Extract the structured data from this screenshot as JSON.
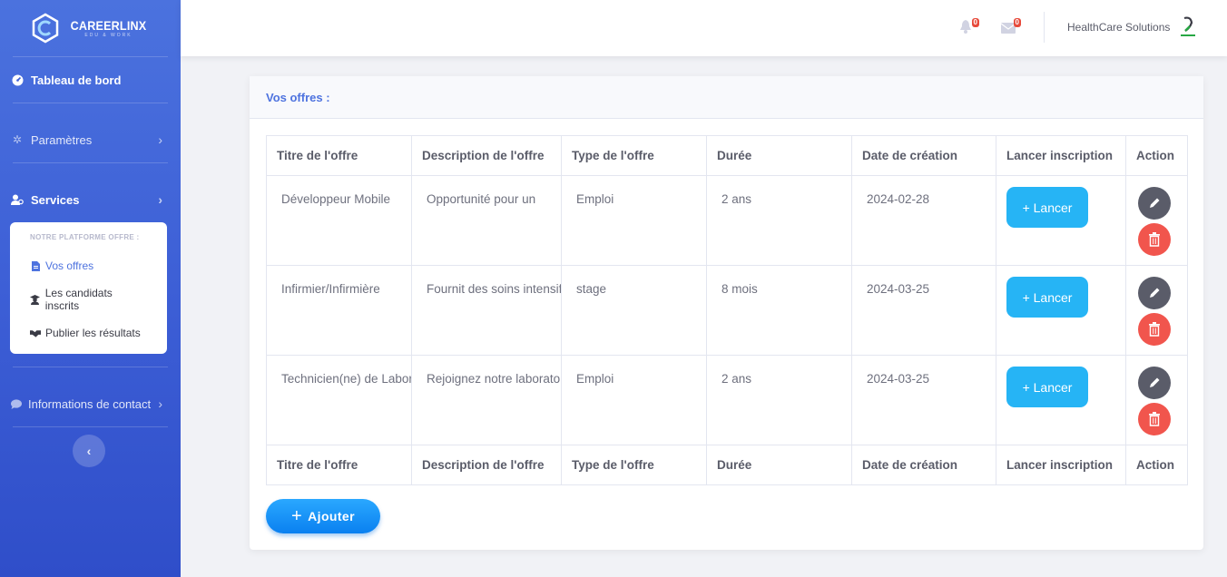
{
  "brand": {
    "name": "CAREERLINX",
    "tagline": "EDU & WORK"
  },
  "sidebar": {
    "dashboard": "Tableau de bord",
    "settings": "Paramètres",
    "services": "Services",
    "submenu": {
      "heading": "NOTRE PLATFORME OFFRE :",
      "items": [
        {
          "label": "Vos offres",
          "icon": "file-icon"
        },
        {
          "label": "Les candidats inscrits",
          "icon": "graduate-icon"
        },
        {
          "label": "Publier les résultats",
          "icon": "handshake-icon"
        }
      ]
    },
    "contact": "Informations de contact",
    "toggle": "‹"
  },
  "topbar": {
    "alerts_count": "0",
    "messages_count": "0",
    "user_name": "HealthCare Solutions"
  },
  "card": {
    "title": "Vos offres :",
    "columns": [
      "Titre de l'offre",
      "Description de l'offre",
      "Type de l'offre",
      "Durée",
      "Date de création",
      "Lancer inscription",
      "Action"
    ],
    "rows": [
      {
        "title": "Développeur Mobile",
        "description": "Opportunité pour un",
        "type": "Emploi",
        "duration": "2 ans",
        "date": "2024-02-28"
      },
      {
        "title": "Infirmier/Infirmière",
        "description": "Fournit des soins intensifs",
        "type": "stage",
        "duration": "8 mois",
        "date": "2024-03-25"
      },
      {
        "title": "Technicien(ne) de Laboratoire",
        "description": "Rejoignez notre laboratoire",
        "type": "Emploi",
        "duration": "2 ans",
        "date": "2024-03-25"
      }
    ],
    "lancer_label": "+ Lancer",
    "add_label": "Ajouter"
  },
  "colors": {
    "sidebar": "#4b72de",
    "accent": "#4e73df",
    "lancer": "#26b4f5",
    "delete": "#f1554d",
    "edit": "#5a5c69"
  }
}
